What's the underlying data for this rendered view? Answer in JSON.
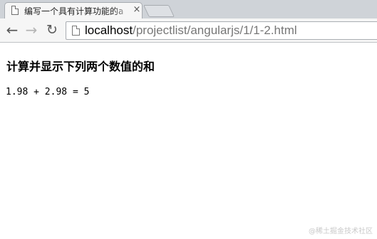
{
  "browser": {
    "tab": {
      "title": "编写一个具有计算功能的a",
      "close_glyph": "×"
    },
    "toolbar": {
      "back_glyph": "←",
      "forward_glyph": "→",
      "reload_glyph": "↻"
    },
    "address": {
      "host": "localhost",
      "path": "/projectlist/angularjs/1/1-2.html"
    }
  },
  "page": {
    "heading": "计算并显示下列两个数值的和",
    "sum": {
      "a": "1.98",
      "plus": "+",
      "b": "2.98",
      "equals": "=",
      "result": "5"
    }
  },
  "watermark": "@稀土掘金技术社区"
}
